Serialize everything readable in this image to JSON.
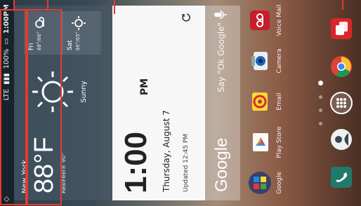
{
  "status_bar": {
    "network": "LTE",
    "battery": "100%",
    "time": "1:00PM"
  },
  "weather": {
    "city": "New York",
    "temperature": "88°F",
    "feels_like": "RealFeel® 90°",
    "condition": "Sunny",
    "forecast": [
      {
        "day": "Fri",
        "temps": "88°/66°"
      },
      {
        "day": "Sat",
        "temps": "86°/65°"
      }
    ]
  },
  "clock": {
    "time": "1:00",
    "ampm": "PM",
    "date": "Thursday, August 7",
    "updated": "Updated 12:45 PM"
  },
  "search": {
    "brand": "Google",
    "prompt": "Say \"Ok Google\""
  },
  "apps": [
    {
      "label": "Google",
      "icon": "google-folder-icon"
    },
    {
      "label": "Play Store",
      "icon": "play-store-icon"
    },
    {
      "label": "Email",
      "icon": "email-icon"
    },
    {
      "label": "Camera",
      "icon": "camera-icon"
    },
    {
      "label": "Voice Mail",
      "icon": "voicemail-icon"
    }
  ],
  "dock": [
    {
      "icon": "phone-icon"
    },
    {
      "icon": "contacts-icon"
    },
    {
      "icon": "app-drawer-icon"
    },
    {
      "icon": "chrome-icon"
    },
    {
      "icon": "messaging-icon"
    }
  ],
  "colors": {
    "annotation": "#e63a2f",
    "clock_bg": "#f7f7f7",
    "phone_icon": "#1f7a6c",
    "voicemail_icon": "#c81d2a",
    "messaging_icon": "#d9262b"
  }
}
